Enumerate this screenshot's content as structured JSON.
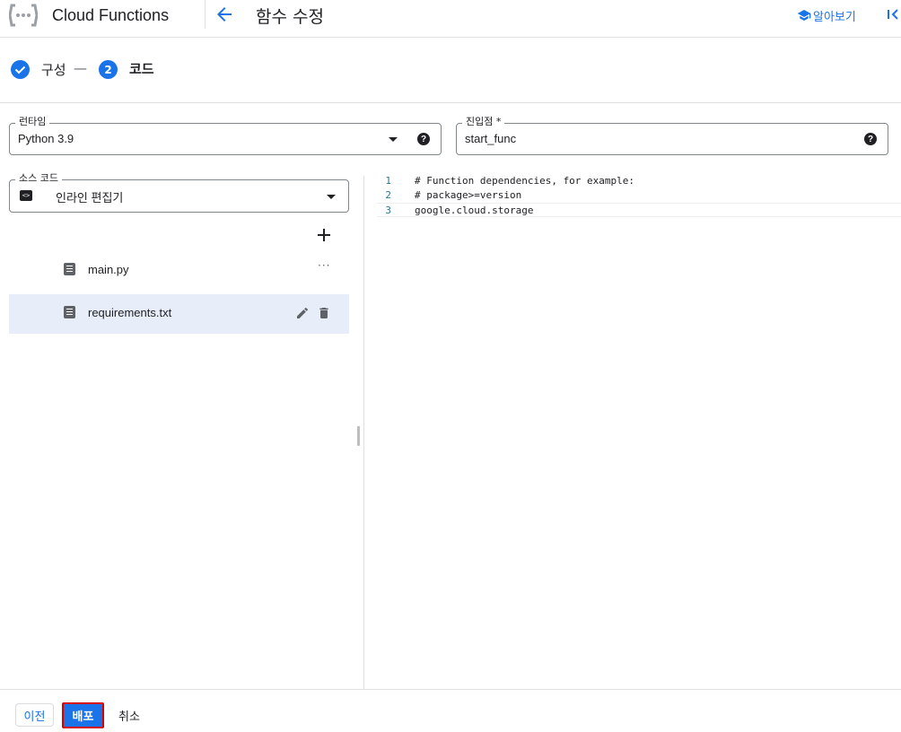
{
  "header": {
    "app_title": "Cloud Functions",
    "page_title": "함수 수정",
    "learn_label": "알아보기"
  },
  "stepper": {
    "steps": [
      {
        "label": "구성",
        "state": "complete"
      },
      {
        "number": "2",
        "label": "코드",
        "state": "active"
      }
    ],
    "separator": "—"
  },
  "form": {
    "runtime": {
      "label": "런타임",
      "value": "Python 3.9"
    },
    "entry_point": {
      "label": "진입점 *",
      "value": "start_func"
    },
    "source_code": {
      "label": "소스 코드",
      "value": "인라인 편집기"
    }
  },
  "files": [
    {
      "name": "main.py",
      "selected": false
    },
    {
      "name": "requirements.txt",
      "selected": true
    }
  ],
  "editor": {
    "lines": [
      {
        "number": "1",
        "text": "# Function dependencies, for example:"
      },
      {
        "number": "2",
        "text": "# package>=version"
      },
      {
        "number": "3",
        "text": "google.cloud.storage"
      }
    ]
  },
  "footer": {
    "prev_label": "이전",
    "deploy_label": "배포",
    "cancel_label": "취소"
  },
  "colors": {
    "accent": "#1a73e8",
    "highlight_border": "#d50000",
    "selected_row": "#e8eef9",
    "line_number": "#237893"
  },
  "icons": [
    "cloud-functions-logo-icon",
    "arrow-back-icon",
    "school-icon",
    "collapse-panel-icon",
    "check-icon",
    "dropdown-arrow-icon",
    "help-icon",
    "code-icon",
    "add-icon",
    "file-icon",
    "more-icon",
    "edit-icon",
    "delete-icon"
  ]
}
